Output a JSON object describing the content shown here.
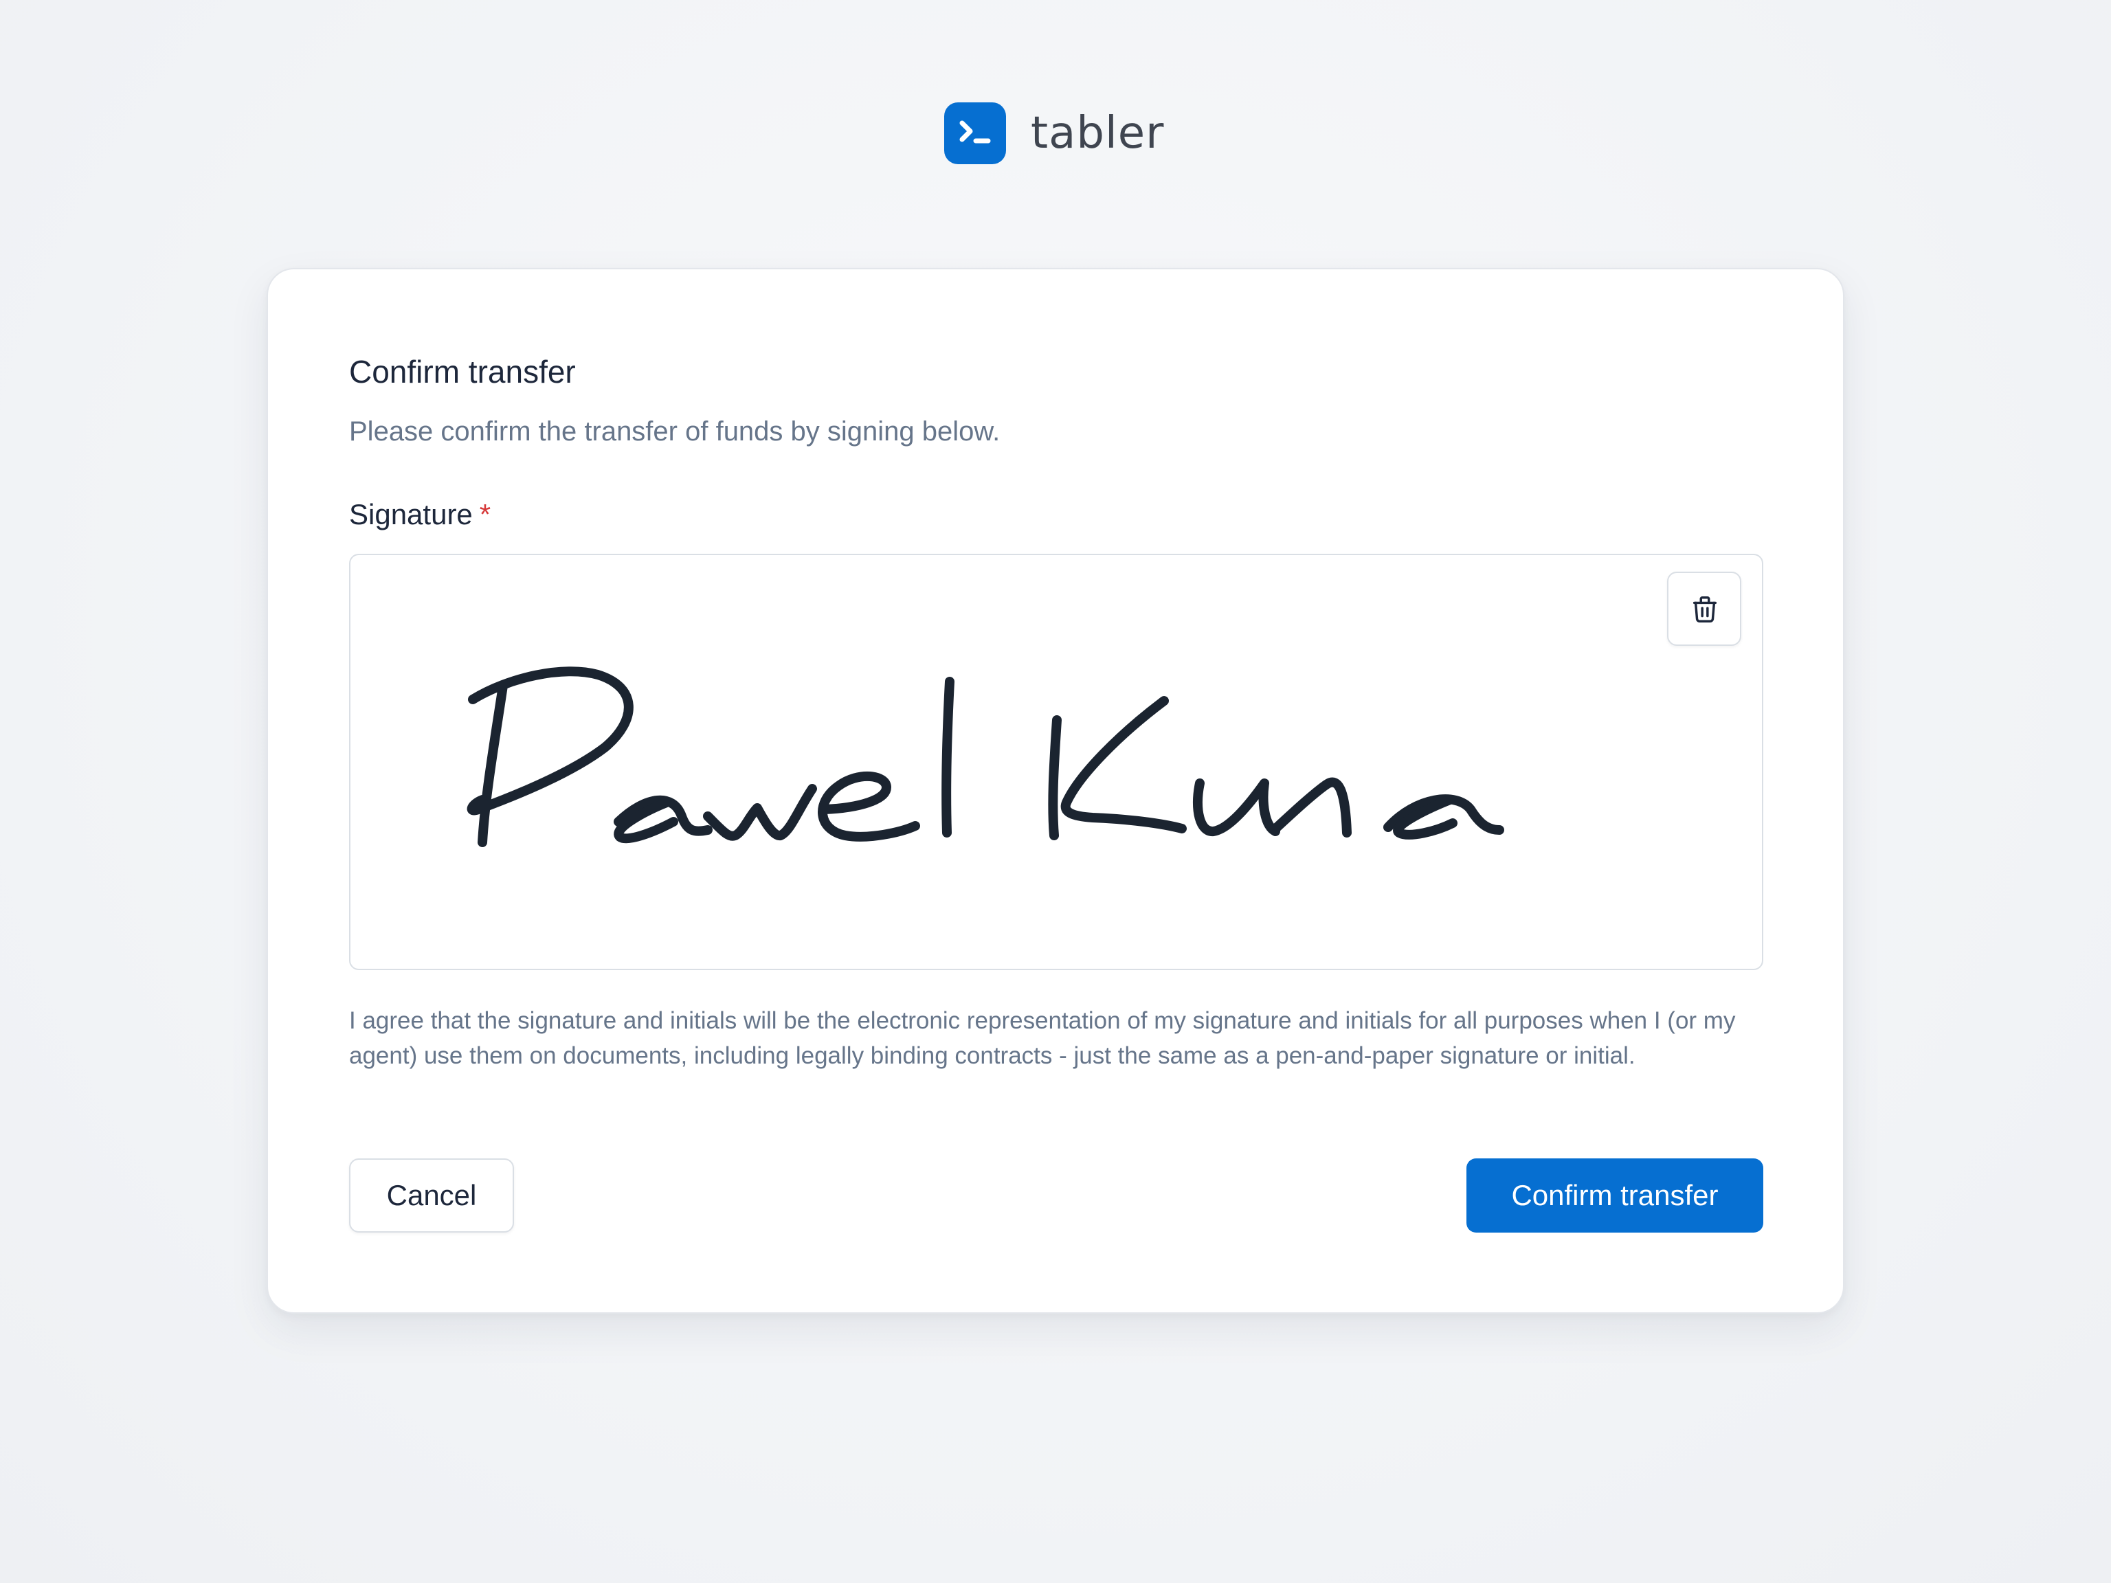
{
  "brand": {
    "name": "tabler",
    "logo_icon": "terminal-icon",
    "accent_color": "#066fd1"
  },
  "card": {
    "title": "Confirm transfer",
    "subtitle": "Please confirm the transfer of funds by signing below."
  },
  "signature_field": {
    "label": "Signature",
    "required_marker": "*",
    "clear_icon": "trash-icon",
    "signature_text": "Pawel Kuna"
  },
  "consent": {
    "text": "I agree that the signature and initials will be the electronic representation of my signature and initials for all purposes when I (or my agent) use them on documents, including legally binding contracts - just the same as a pen-and-paper signature or initial."
  },
  "actions": {
    "cancel_label": "Cancel",
    "confirm_label": "Confirm transfer"
  }
}
